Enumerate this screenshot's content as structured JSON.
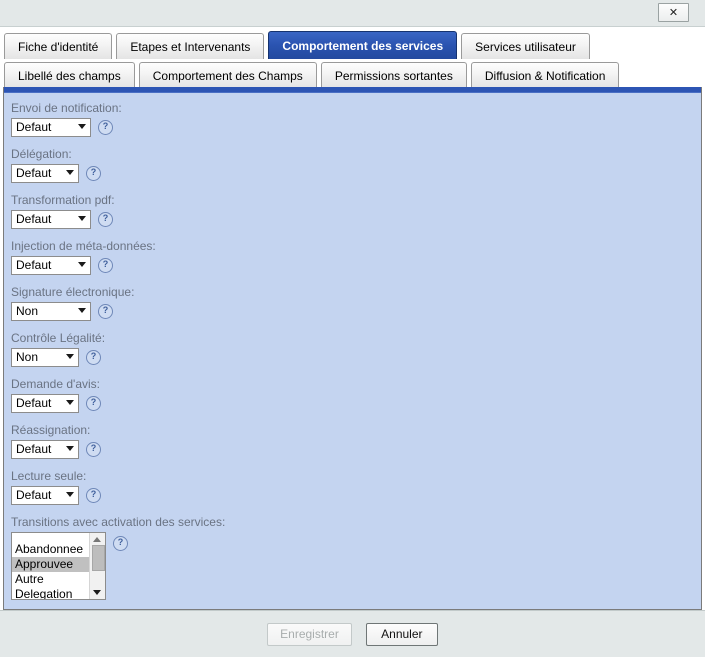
{
  "titlebar": {
    "close_label": "✕"
  },
  "tabs": {
    "row1": [
      {
        "label": "Fiche d'identité",
        "active": false
      },
      {
        "label": "Etapes et Intervenants",
        "active": false
      },
      {
        "label": "Comportement des services",
        "active": true
      },
      {
        "label": "Services utilisateur",
        "active": false
      }
    ],
    "row2": [
      {
        "label": "Libellé des champs",
        "active": false
      },
      {
        "label": "Comportement des Champs",
        "active": false
      },
      {
        "label": "Permissions sortantes",
        "active": false
      },
      {
        "label": "Diffusion & Notification",
        "active": false
      }
    ]
  },
  "form": {
    "help_icon": "?",
    "fields": [
      {
        "label": "Envoi de notification:",
        "value": "Defaut",
        "width": 80
      },
      {
        "label": "Délégation:",
        "value": "Defaut",
        "width": 68
      },
      {
        "label": "Transformation pdf:",
        "value": "Defaut",
        "width": 80
      },
      {
        "label": "Injection de méta-données:",
        "value": "Defaut",
        "width": 80
      },
      {
        "label": "Signature électronique:",
        "value": "Non",
        "width": 80
      },
      {
        "label": "Contrôle Légalité:",
        "value": "Non",
        "width": 68
      },
      {
        "label": "Demande d'avis:",
        "value": "Defaut",
        "width": 68
      },
      {
        "label": "Réassignation:",
        "value": "Defaut",
        "width": 68
      },
      {
        "label": "Lecture seule:",
        "value": "Defaut",
        "width": 68
      }
    ],
    "transitions": {
      "label": "Transitions avec activation des services:",
      "items": [
        {
          "label": "Abandonnee",
          "selected": false
        },
        {
          "label": "Approuvee",
          "selected": true
        },
        {
          "label": "Autre",
          "selected": false
        },
        {
          "label": "Delegation",
          "selected": false
        }
      ]
    }
  },
  "footer": {
    "save_label": "Enregistrer",
    "save_disabled": true,
    "cancel_label": "Annuler"
  },
  "colors": {
    "panel_bg": "#c4d4f0",
    "active_tab": "#2a53b0",
    "label_text": "#6a7383",
    "titlebar_bg": "#e3e8e8"
  }
}
